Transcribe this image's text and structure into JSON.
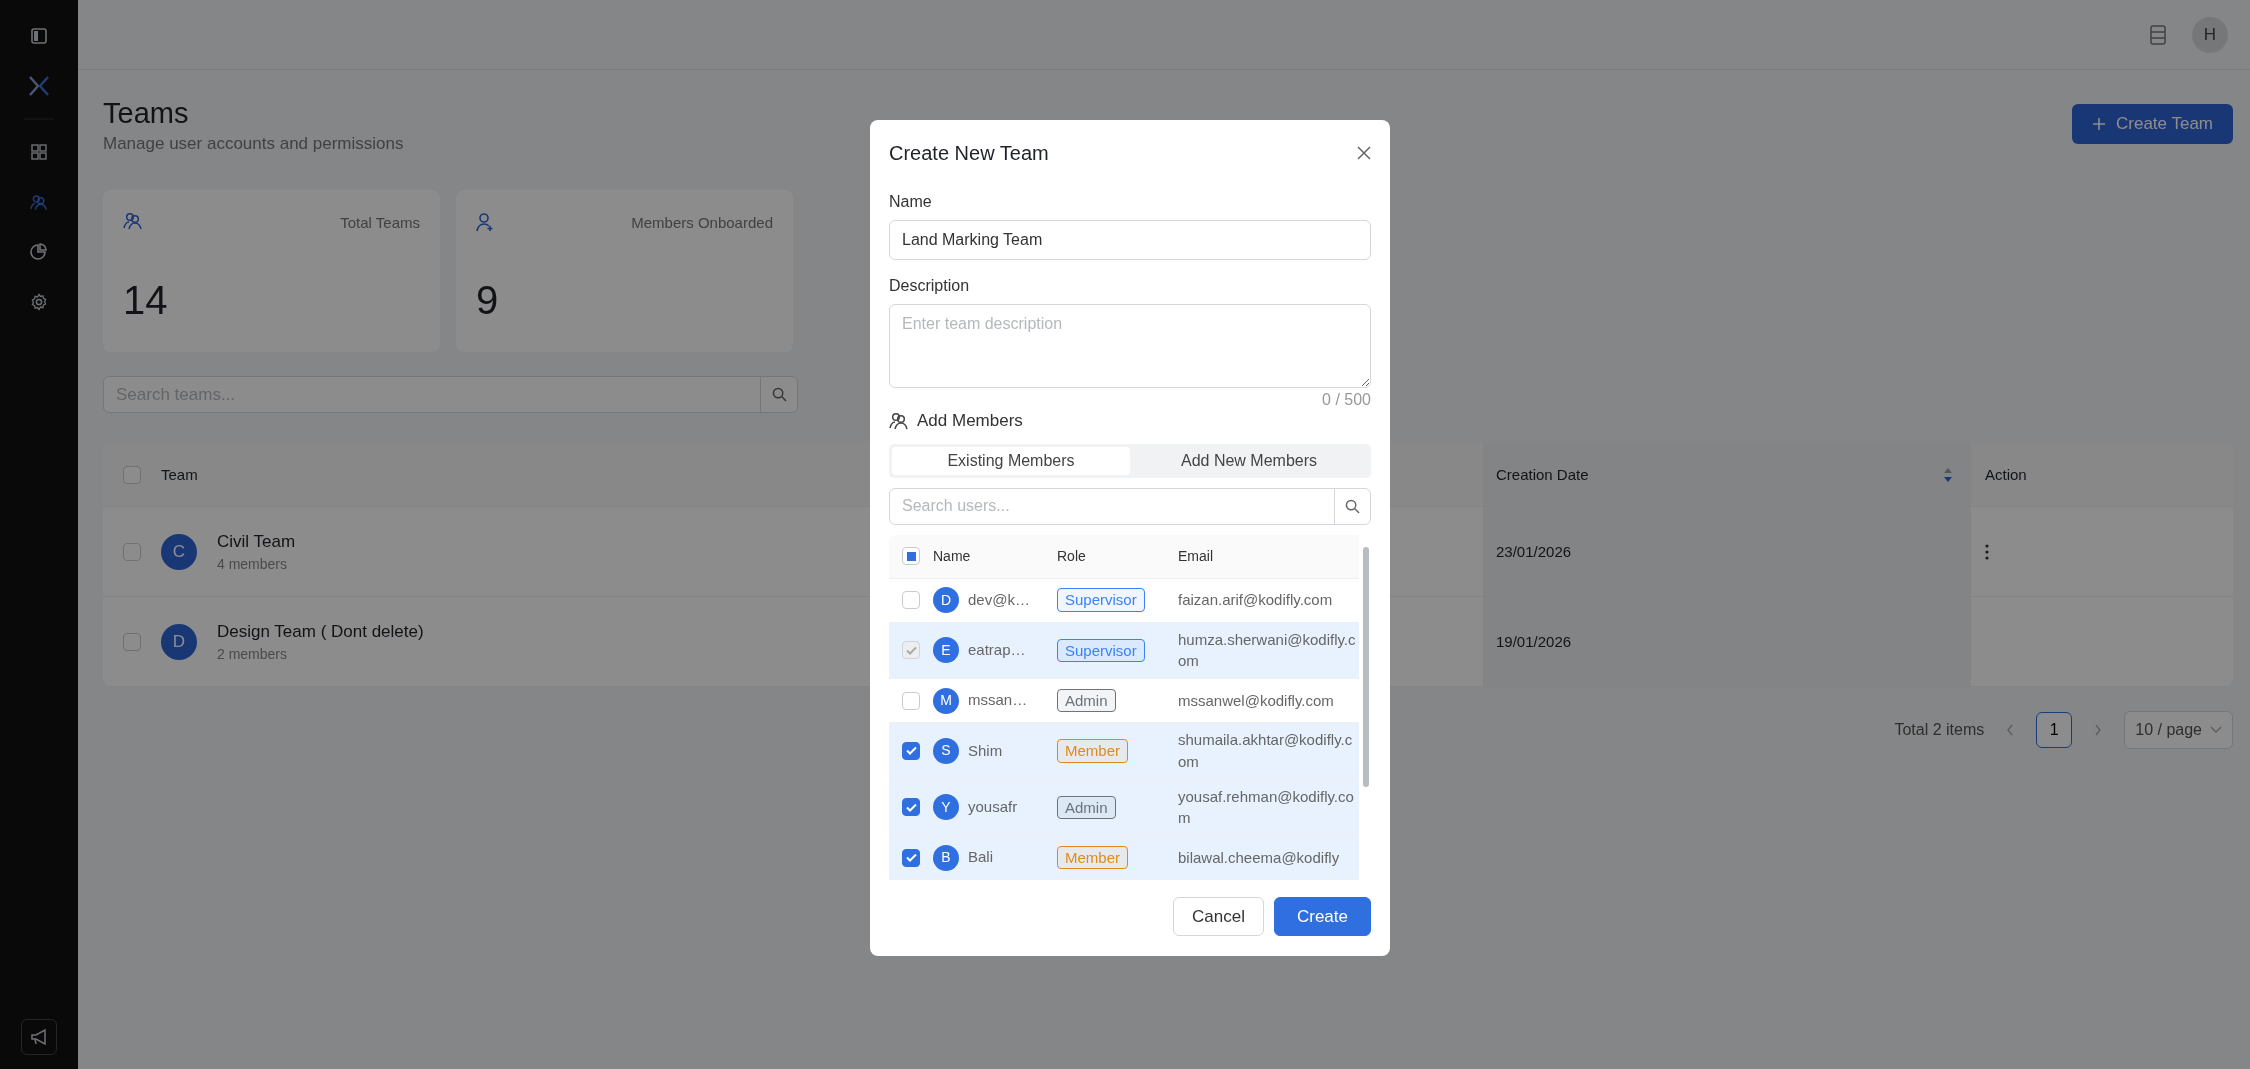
{
  "sidebar": {
    "items": [
      {
        "kind": "grid",
        "selected": false
      },
      {
        "kind": "users",
        "selected": true
      },
      {
        "kind": "chart",
        "selected": false
      },
      {
        "kind": "gear",
        "selected": false
      }
    ]
  },
  "header": {
    "avatar": "H"
  },
  "page": {
    "title": "Teams",
    "subtitle": "Manage user accounts and permissions",
    "create_button": "Create Team"
  },
  "stats": [
    {
      "kind": "teams",
      "label": "Total Teams",
      "value": "14"
    },
    {
      "kind": "member",
      "label": "Members Onboarded",
      "value": "9"
    }
  ],
  "search": {
    "placeholder": "Search teams..."
  },
  "table": {
    "select_all": {
      "checked": false
    },
    "columns": [
      {
        "label": "Team",
        "sorted": false
      },
      {
        "label": "Creation Date",
        "sorted": true
      },
      {
        "label": "Action",
        "sorted": false
      }
    ],
    "rows": [
      {
        "initial": "C",
        "name": "Civil Team",
        "members": "4 members",
        "date": "23/01/2026",
        "menu": true,
        "checked": false
      },
      {
        "initial": "D",
        "name": "Design Team ( Dont delete)",
        "members": "2 members",
        "date": "19/01/2026",
        "menu": false,
        "checked": false
      }
    ]
  },
  "pagination": {
    "total": "Total 2 items",
    "pages": [
      {
        "label": "1",
        "selected": true
      }
    ],
    "page_size": "10 / page"
  },
  "modal": {
    "title": "Create New Team",
    "name_label": "Name",
    "name_value": "Land Marking Team",
    "description_label": "Description",
    "description_placeholder": "Enter team description",
    "counter": "0 / 500",
    "members_label": "Add Members",
    "tabs": [
      {
        "label": "Existing Members",
        "selected": true
      },
      {
        "label": "Add New Members",
        "selected": false
      }
    ],
    "user_search": {
      "placeholder": "Search users..."
    },
    "columns": [
      "Name",
      "Role",
      "Email"
    ],
    "select_all": {
      "indeterminate": true
    },
    "users": [
      {
        "initial": "D",
        "name": "dev@k…",
        "role": {
          "text": "Supervisor",
          "color": "#3b82f6"
        },
        "email": "faizan.arif@kodifly.com",
        "checked": false,
        "disabled": false,
        "selected": false
      },
      {
        "initial": "E",
        "name": "eatrap…",
        "role": {
          "text": "Supervisor",
          "color": "#3b82f6"
        },
        "email": "humza.sherwani@kodifly.com",
        "checked": true,
        "disabled": true,
        "selected": true
      },
      {
        "initial": "M",
        "name": "mssan…",
        "role": {
          "text": "Admin",
          "color": "#6b7280"
        },
        "email": "mssanwel@kodifly.com",
        "checked": false,
        "disabled": false,
        "selected": false
      },
      {
        "initial": "S",
        "name": "Shim",
        "role": {
          "text": "Member",
          "color": "#e08a1e"
        },
        "email": "shumaila.akhtar@kodifly.com",
        "checked": true,
        "disabled": false,
        "selected": true
      },
      {
        "initial": "Y",
        "name": "yousafr",
        "role": {
          "text": "Admin",
          "color": "#6b7280"
        },
        "email": "yousaf.rehman@kodifly.com",
        "checked": true,
        "disabled": false,
        "selected": true
      },
      {
        "initial": "B",
        "name": "Bali",
        "role": {
          "text": "Member",
          "color": "#e08a1e"
        },
        "email": "bilawal.cheema@kodifly",
        "checked": true,
        "disabled": false,
        "selected": true
      }
    ],
    "buttons": [
      {
        "label": "Cancel",
        "kind": "secondary"
      },
      {
        "label": "Create",
        "kind": "primary"
      }
    ]
  }
}
